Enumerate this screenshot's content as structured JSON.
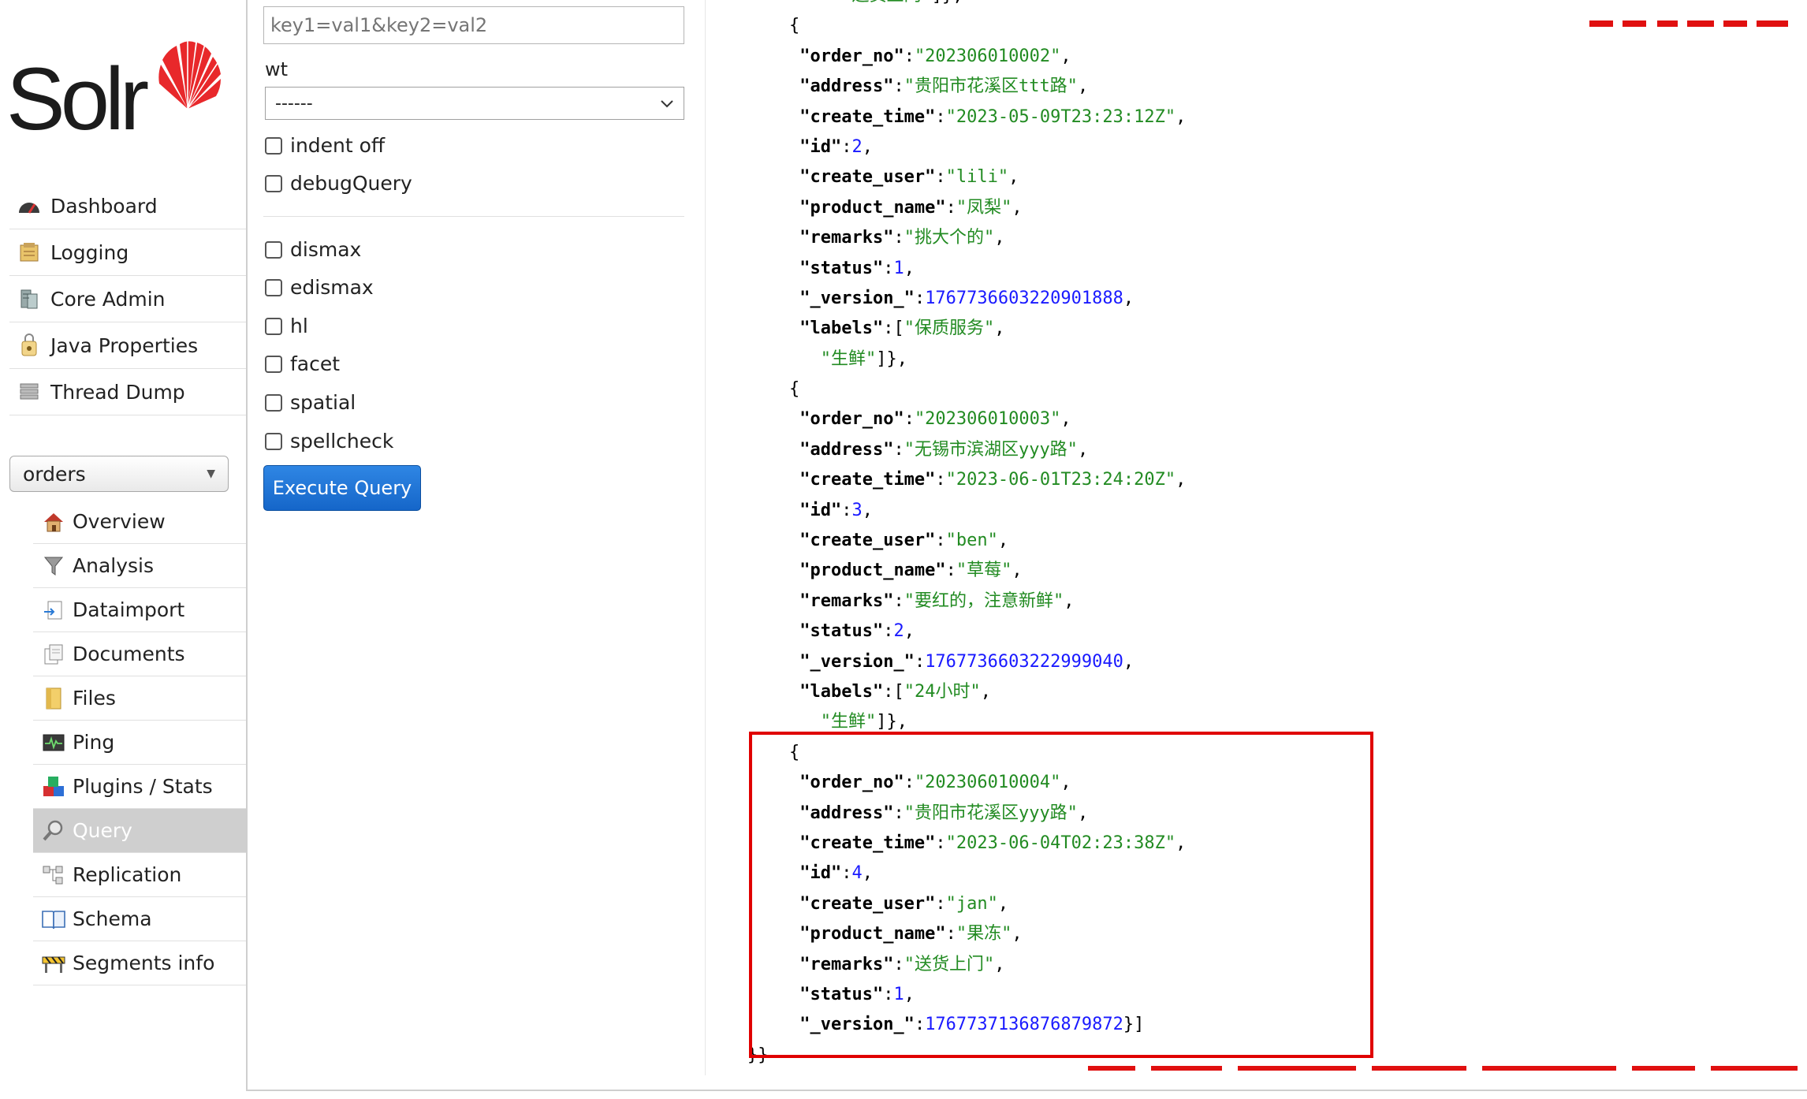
{
  "brand": {
    "logo_text": "Solr",
    "accent": "#e8282b"
  },
  "nav": {
    "items": [
      {
        "label": "Dashboard",
        "icon": "dashboard-icon"
      },
      {
        "label": "Logging",
        "icon": "logging-icon"
      },
      {
        "label": "Core Admin",
        "icon": "core-admin-icon"
      },
      {
        "label": "Java Properties",
        "icon": "java-properties-icon"
      },
      {
        "label": "Thread Dump",
        "icon": "thread-dump-icon"
      }
    ]
  },
  "core_selector": {
    "value": "orders"
  },
  "core_nav": {
    "active": "Query",
    "items": [
      {
        "label": "Overview",
        "icon": "home-icon"
      },
      {
        "label": "Analysis",
        "icon": "funnel-icon"
      },
      {
        "label": "Dataimport",
        "icon": "dataimport-icon"
      },
      {
        "label": "Documents",
        "icon": "documents-icon"
      },
      {
        "label": "Files",
        "icon": "folder-icon"
      },
      {
        "label": "Ping",
        "icon": "ping-icon"
      },
      {
        "label": "Plugins / Stats",
        "icon": "plugins-icon"
      },
      {
        "label": "Query",
        "icon": "magnifier-icon"
      },
      {
        "label": "Replication",
        "icon": "replication-icon"
      },
      {
        "label": "Schema",
        "icon": "schema-icon"
      },
      {
        "label": "Segments info",
        "icon": "segments-icon"
      }
    ]
  },
  "form": {
    "params_placeholder": "key1=val1&key2=val2",
    "wt_label": "wt",
    "wt_value": "------",
    "checkboxes": {
      "indent_off": "indent off",
      "debug_query": "debugQuery",
      "dismax": "dismax",
      "edismax": "edismax",
      "hl": "hl",
      "facet": "facet",
      "spatial": "spatial",
      "spellcheck": "spellcheck"
    },
    "execute_label": "Execute Query"
  },
  "results": {
    "lead_fragment": {
      "value": "送货上门",
      "tail": "]},"
    },
    "docs": [
      {
        "order_no": "202306010002",
        "address": "贵阳市花溪区ttt路",
        "create_time": "2023-05-09T23:23:12Z",
        "id": "2",
        "create_user": "lili",
        "product_name": "凤梨",
        "remarks": "挑大个的",
        "status": "1",
        "version": "1767736603220901888",
        "labels": [
          "保质服务",
          "生鲜"
        ]
      },
      {
        "order_no": "202306010003",
        "address": "无锡市滨湖区yyy路",
        "create_time": "2023-06-01T23:24:20Z",
        "id": "3",
        "create_user": "ben",
        "product_name": "草莓",
        "remarks": "要红的，注意新鲜",
        "status": "2",
        "version": "1767736603222999040",
        "labels": [
          "24小时",
          "生鲜"
        ]
      },
      {
        "order_no": "202306010004",
        "address": "贵阳市花溪区yyy路",
        "create_time": "2023-06-04T02:23:38Z",
        "id": "4",
        "create_user": "jan",
        "product_name": "果冻",
        "remarks": "送货上门",
        "status": "1",
        "version": "1767737136876879872"
      }
    ],
    "closing": "}}"
  },
  "colors": {
    "highlight_border": "#e00000",
    "string": "#228b22",
    "number": "#1a1aff"
  }
}
